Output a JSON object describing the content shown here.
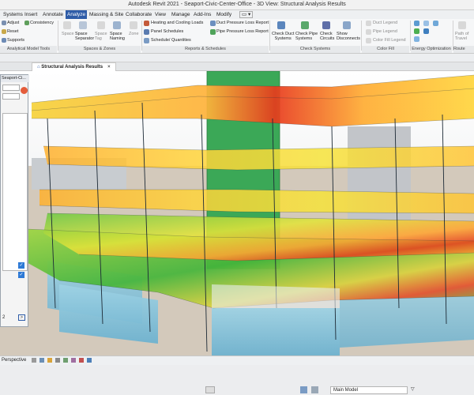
{
  "app": {
    "title": "Autodesk Revit 2021 - Seaport-Civic-Center-Office - 3D View: Structural Analysis Results"
  },
  "tabs": [
    "Systems",
    "Insert",
    "Annotate",
    "Analyze",
    "Massing & Site",
    "Collaborate",
    "View",
    "Manage",
    "Add-Ins",
    "Modify"
  ],
  "active_tab": "Analyze",
  "ribbon": {
    "adjust": "Adjust",
    "consistency": "Consistency",
    "reset": "Reset",
    "supports": "Supports",
    "space": "Space",
    "space_separator": "Space\nSeparator",
    "space_tag": "Space\nTag",
    "space_naming": "Space\nNaming",
    "zone": "Zone",
    "heating_cooling": "Heating and Cooling Loads",
    "panel_schedules": "Panel Schedules",
    "schedule_quantities": "Schedule/ Quantities",
    "duct_pressure": "Duct Pressure Loss Report",
    "pipe_pressure": "Pipe Pressure Loss Report",
    "check_duct": "Check Duct\nSystems",
    "check_pipe": "Check Pipe\nSystems",
    "check_circuits": "Check\nCircuits",
    "show_disconnects": "Show\nDisconnects",
    "duct_legend": "Duct Legend",
    "pipe_legend": "Pipe Legend",
    "color_fill_legend": "Color Fill Legend",
    "path_of_travel": "Path of\nTravel",
    "panels": [
      "Analytical Model Tools",
      "Spaces & Zones",
      "Reports & Schedules",
      "Check Systems",
      "Color Fill",
      "Energy Optimization",
      "Route Analy"
    ]
  },
  "doc_tab": "Structural Analysis Results",
  "dialog": {
    "title": "Seaport-Ci...",
    "value": "2"
  },
  "status": {
    "view": "Perspective",
    "main_model": "Main Model"
  },
  "colors": {
    "accent": "#2e5ca8",
    "green_tower": "#3da85a",
    "water": "#8fc9de"
  }
}
